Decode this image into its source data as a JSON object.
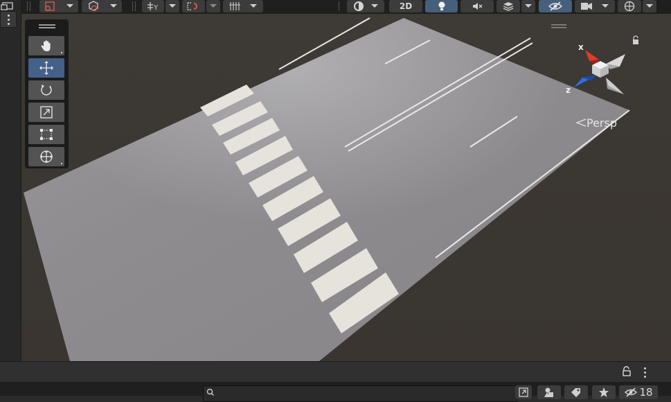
{
  "toolbar": {
    "two_d_label": "2D",
    "icons": [
      "gizmo-select-icon",
      "draw-mode-icon",
      "pivot-icon",
      "snap-icon",
      "grid-snap-icon",
      "shading-mode-icon",
      "lighting-icon",
      "audio-icon",
      "effects-icon",
      "scene-visibility-icon",
      "camera-icon",
      "gizmos-icon"
    ]
  },
  "tools": {
    "items": [
      {
        "name": "hand-tool",
        "icon": "hand-icon",
        "active": false
      },
      {
        "name": "move-tool",
        "icon": "move-icon",
        "active": true
      },
      {
        "name": "rotate-tool",
        "icon": "rotate-icon",
        "active": false
      },
      {
        "name": "scale-tool",
        "icon": "scale-icon",
        "active": false
      },
      {
        "name": "rect-tool",
        "icon": "rect-transform-icon",
        "active": false
      },
      {
        "name": "transform-tool",
        "icon": "transform-icon",
        "active": false
      }
    ]
  },
  "gizmo": {
    "x_label": "x",
    "z_label": "z",
    "projection_label": "Persp",
    "colors": {
      "x": "#e03a2a",
      "y": "#8bc34a",
      "z": "#2e6fe0",
      "neutral": "#c8c8c8"
    }
  },
  "bottom": {
    "search_placeholder": "",
    "hidden_count": "18"
  },
  "colors": {
    "accent": "#46607c",
    "road": "#8f8d8f",
    "background": "#3c3834"
  }
}
